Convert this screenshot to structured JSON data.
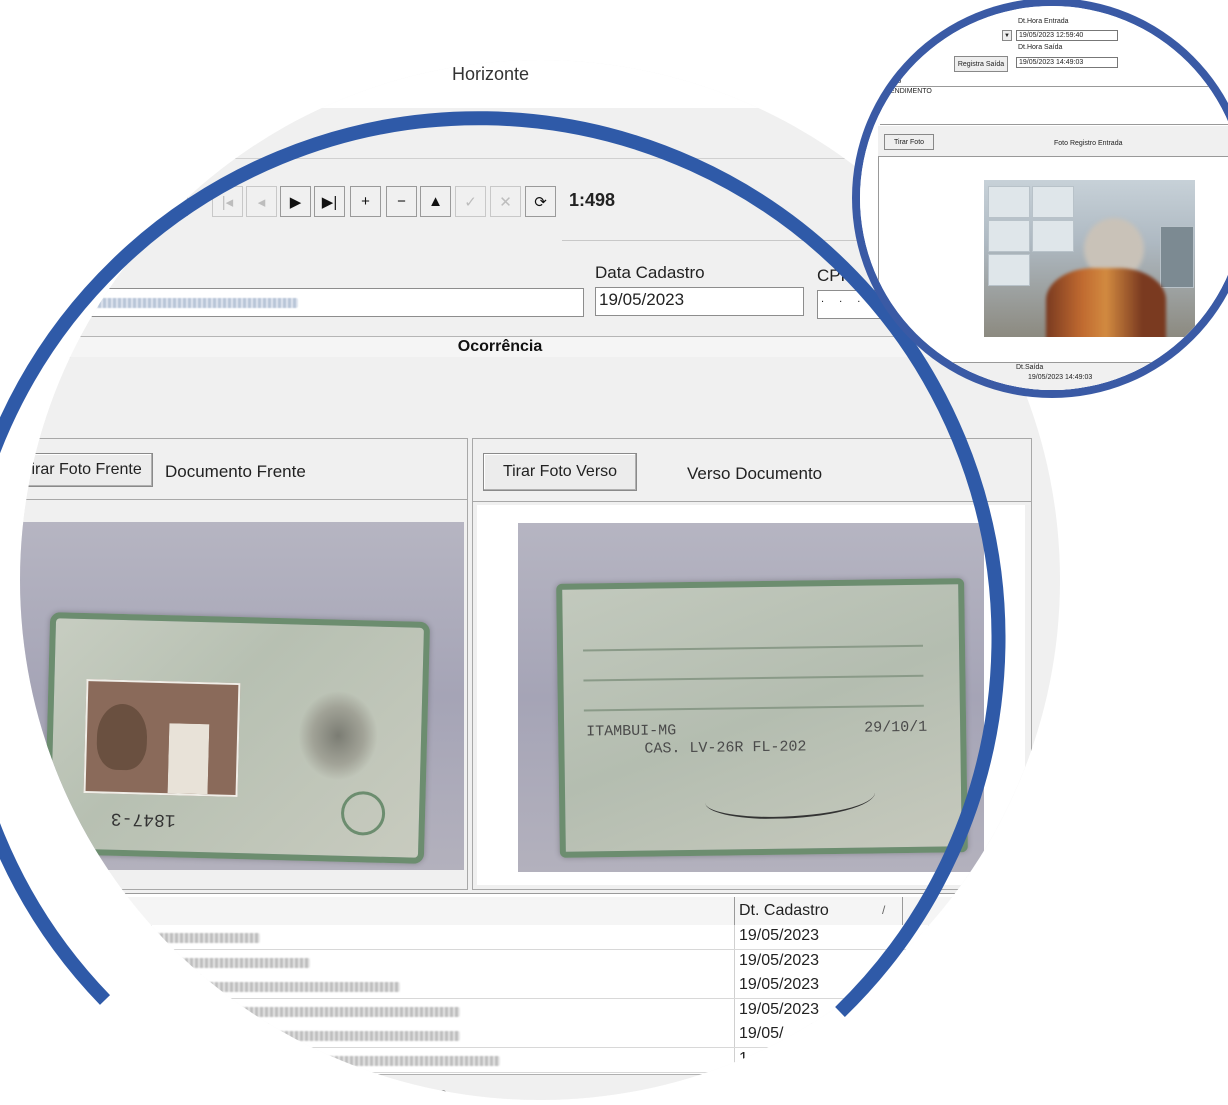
{
  "window": {
    "title_fragment": "Horizonte"
  },
  "navigator": {
    "buttons": [
      {
        "name": "first",
        "glyph": "|◂",
        "enabled": false
      },
      {
        "name": "prior",
        "glyph": "◂",
        "enabled": false
      },
      {
        "name": "next",
        "glyph": "▶",
        "enabled": true
      },
      {
        "name": "last",
        "glyph": "▶|",
        "enabled": true
      },
      {
        "name": "insert",
        "glyph": "+",
        "enabled": true
      },
      {
        "name": "delete",
        "glyph": "−",
        "enabled": true
      },
      {
        "name": "edit",
        "glyph": "▲",
        "enabled": true
      },
      {
        "name": "post",
        "glyph": "✓",
        "enabled": false
      },
      {
        "name": "cancel",
        "glyph": "✕",
        "enabled": false
      },
      {
        "name": "refresh",
        "glyph": "⟳",
        "enabled": true
      }
    ],
    "record_counter": "1:498"
  },
  "form": {
    "data_cadastro_label": "Data Cadastro",
    "data_cadastro_value": "19/05/2023",
    "cpf_label": "CPF",
    "cpf_value": ". . ."
  },
  "ocorrencia": {
    "header": "Ocorrência"
  },
  "documents": {
    "front_button": "Tirar Foto Frente",
    "front_label": "Documento Frente",
    "back_button": "Tirar Foto Verso",
    "back_label": "Verso Documento",
    "front_card_number": "1847-3",
    "back_card_lines": [
      "ITAMBUI-MG",
      "CAS. LV-26R FL-202",
      "29/10/1"
    ]
  },
  "grid": {
    "column_header": "Dt. Cadastro",
    "sort_indicator": "/",
    "rows": [
      "19/05/2023",
      "19/05/2023",
      "19/05/2023",
      "19/05/2023",
      "19/05/",
      "1"
    ],
    "footer_text": "hos"
  },
  "inset": {
    "entrada_label": "Dt.Hora Entrada",
    "entrada_value": "19/05/2023 12:59:40",
    "saida_label": "Dt.Hora Saída",
    "saida_value": "19/05/2023 14:49:03",
    "registra_saida_button": "Registra Saída",
    "cut_label": "ção",
    "atendimento": "ENDIMENTO",
    "tirar_foto_button": "Tirar Foto",
    "foto_registro_label": "Foto Registro Entrada",
    "dt_saida_label": "Dt.Saída",
    "dt_saida_value": "19/05/2023 14:49:03"
  },
  "colors": {
    "circle_border": "#2f5aa8",
    "window_bg": "#f0f0f0"
  }
}
